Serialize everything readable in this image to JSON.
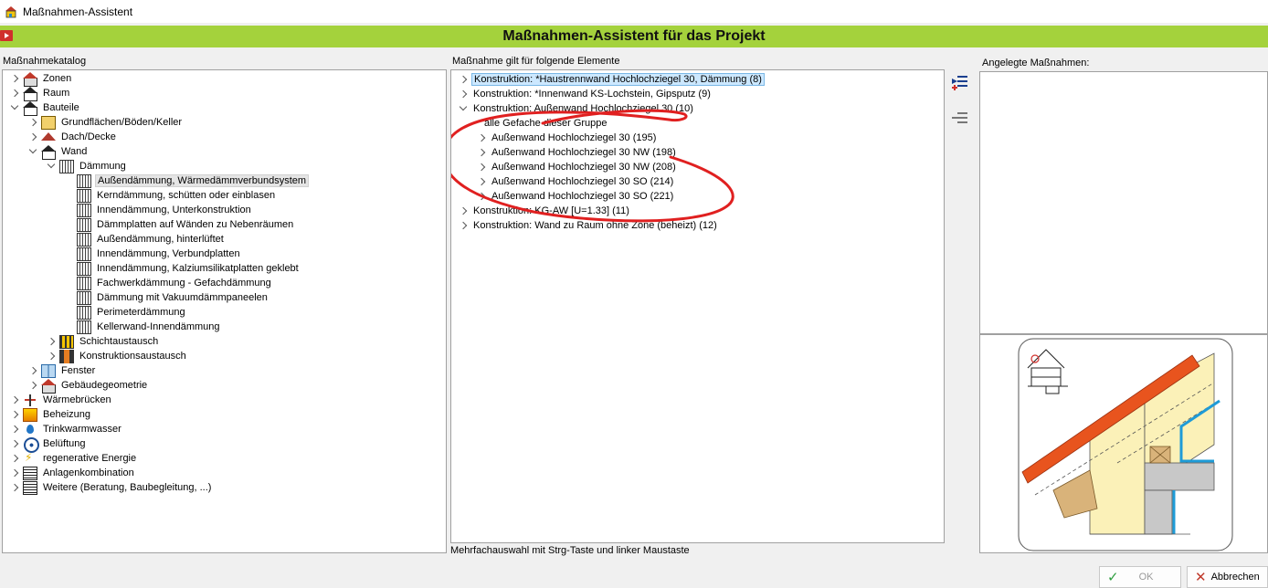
{
  "window": {
    "title": "Maßnahmen-Assistent"
  },
  "banner": {
    "title": "Maßnahmen-Assistent für das Projekt"
  },
  "catalog": {
    "label": "Maßnahmekatalog",
    "items": [
      {
        "label": "Zonen",
        "icon": "house-icon"
      },
      {
        "label": "Raum",
        "icon": "room-icon"
      },
      {
        "label": "Bauteile",
        "icon": "house-outline-icon"
      },
      {
        "label": "Grundflächen/Böden/Keller",
        "icon": "floor-icon"
      },
      {
        "label": "Dach/Decke",
        "icon": "roof-icon"
      },
      {
        "label": "Wand",
        "icon": "house-outline-icon"
      },
      {
        "label": "Dämmung",
        "icon": "insulation-icon"
      },
      {
        "label": "Außendämmung, Wärmedämmverbundsystem",
        "icon": "insulation-wall-icon"
      },
      {
        "label": "Kerndämmung, schütten oder einblasen",
        "icon": "insulation-wall-icon"
      },
      {
        "label": "Innendämmung, Unterkonstruktion",
        "icon": "insulation-wall-icon"
      },
      {
        "label": "Dämmplatten auf Wänden zu Nebenräumen",
        "icon": "insulation-wall-icon"
      },
      {
        "label": "Außendämmung, hinterlüftet",
        "icon": "insulation-wall-icon"
      },
      {
        "label": "Innendämmung, Verbundplatten",
        "icon": "insulation-wall-icon"
      },
      {
        "label": "Innendämmung, Kalziumsilikatplatten geklebt",
        "icon": "insulation-wall-icon"
      },
      {
        "label": "Fachwerkdämmung - Gefachdämmung",
        "icon": "insulation-wall-icon"
      },
      {
        "label": "Dämmung mit Vakuumdämmpaneelen",
        "icon": "insulation-wall-icon"
      },
      {
        "label": "Perimeterdämmung",
        "icon": "insulation-wall-icon"
      },
      {
        "label": "Kellerwand-Innendämmung",
        "icon": "insulation-wall-icon"
      },
      {
        "label": "Schichtaustausch",
        "icon": "layer-swap-icon"
      },
      {
        "label": "Konstruktionsaustausch",
        "icon": "construction-swap-icon"
      },
      {
        "label": "Fenster",
        "icon": "window-icon"
      },
      {
        "label": "Gebäudegeometrie",
        "icon": "house-icon"
      },
      {
        "label": "Wärmebrücken",
        "icon": "thermal-bridge-icon"
      },
      {
        "label": "Beheizung",
        "icon": "heating-icon"
      },
      {
        "label": "Trinkwarmwasser",
        "icon": "water-drop-icon"
      },
      {
        "label": "Belüftung",
        "icon": "fan-icon"
      },
      {
        "label": "regenerative Energie",
        "icon": "lightning-icon"
      },
      {
        "label": "Anlagenkombination",
        "icon": "document-icon"
      },
      {
        "label": "Weitere (Beratung, Baubegleitung, ...)",
        "icon": "document-icon"
      }
    ]
  },
  "elements": {
    "label": "Maßnahme gilt für folgende Elemente",
    "items": [
      {
        "label": "Konstruktion: *Haustrennwand Hochlochziegel 30, Dämmung (8)"
      },
      {
        "label": "Konstruktion: *Innenwand KS-Lochstein, Gipsputz (9)"
      },
      {
        "label": "Konstruktion: Außenwand Hochlochziegel 30 (10)"
      },
      {
        "label": "alle Gefache dieser Gruppe"
      },
      {
        "label": "Außenwand Hochlochziegel 30 (195)"
      },
      {
        "label": "Außenwand Hochlochziegel 30 NW (198)"
      },
      {
        "label": "Außenwand Hochlochziegel 30 NW (208)"
      },
      {
        "label": "Außenwand Hochlochziegel 30 SO (214)"
      },
      {
        "label": "Außenwand Hochlochziegel 30 SO (221)"
      },
      {
        "label": "Konstruktion: KG-AW [U=1.33] (11)"
      },
      {
        "label": "Konstruktion: Wand zu Raum ohne Zone (beheizt) (12)"
      }
    ],
    "hint": "Mehrfachauswahl mit Strg-Taste und linker Maustaste"
  },
  "created": {
    "label": "Angelegte Maßnahmen:"
  },
  "buttons": {
    "ok": "OK",
    "cancel": "Abbrechen"
  },
  "colors": {
    "banner": "#a4d23c",
    "annotation": "#e02020",
    "selection": "#cce8ff"
  }
}
